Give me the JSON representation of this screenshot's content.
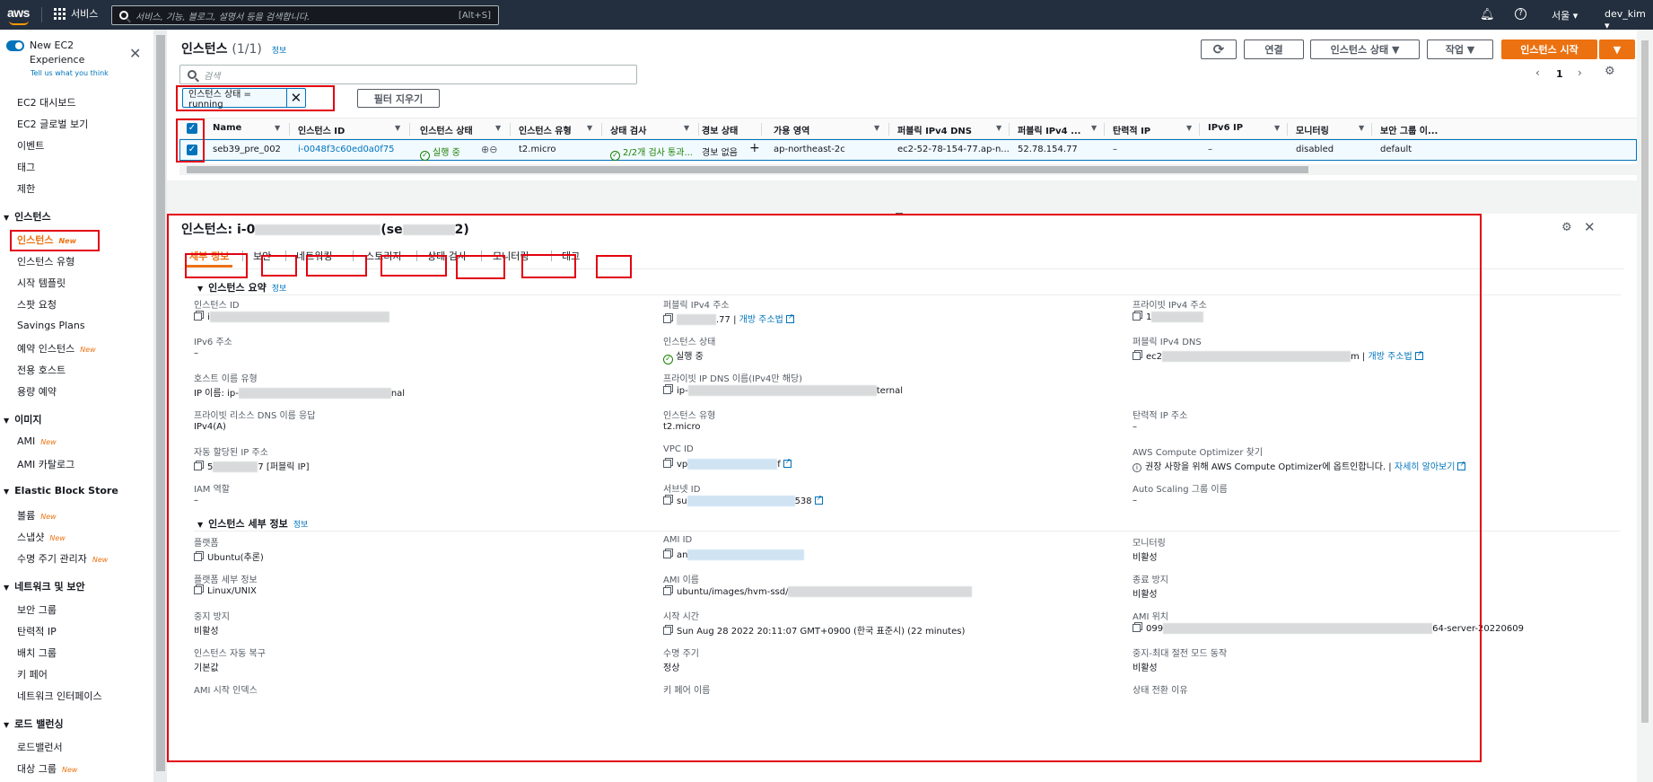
{
  "topbar": {
    "logo": "aws",
    "services": "서비스",
    "search_placeholder": "서비스, 기능, 블로그, 설명서 등을 검색합니다.",
    "search_hotkey": "[Alt+S]",
    "region": "서울 ▾",
    "user": "dev_kim ▾"
  },
  "sidebar": {
    "new_exp": "New EC2 Experience",
    "tell_us": "Tell us what you think",
    "new_badge": "New",
    "items": {
      "dashboard": "EC2 대시보드",
      "global": "EC2 글로벌 보기",
      "events": "이벤트",
      "tags": "태그",
      "limits": "제한",
      "sec_instances": "인스턴스",
      "instances": "인스턴스",
      "instance_types": "인스턴스 유형",
      "launch_templates": "시작 템플릿",
      "spot": "스팟 요청",
      "savings": "Savings Plans",
      "reserved": "예약 인스턴스",
      "dedicated": "전용 호스트",
      "capacity": "용량 예약",
      "sec_images": "이미지",
      "ami": "AMI",
      "ami_catalog": "AMI 카탈로그",
      "sec_ebs": "Elastic Block Store",
      "volumes": "볼륨",
      "snapshots": "스냅샷",
      "lifecycle": "수명 주기 관리자",
      "sec_network": "네트워크 및 보안",
      "security_groups": "보안 그룹",
      "elastic_ip": "탄력적 IP",
      "placement": "배치 그룹",
      "key_pairs": "키 페어",
      "eni": "네트워크 인터페이스",
      "sec_lb": "로드 밸런싱",
      "lb": "로드밸런서",
      "target_groups": "대상 그룹"
    }
  },
  "list": {
    "title": "인스턴스",
    "count": "(1/1)",
    "info": "정보",
    "btn_connect": "연결",
    "btn_state": "인스턴스 상태 ▼",
    "btn_actions": "작업 ▼",
    "btn_launch": "인스턴스 시작",
    "btn_launch_caret": "▼",
    "search_placeholder": "검색",
    "filter_token": "인스턴스 상태 = running",
    "clear_filters": "필터 지우기",
    "page": "1",
    "columns": [
      "Name",
      "인스턴스 ID",
      "인스턴스 상태",
      "인스턴스 유형",
      "상태 검사",
      "경보 상태",
      "가용 영역",
      "퍼블릭 IPv4 DNS",
      "퍼블릭 IPv4 ...",
      "탄력적 IP",
      "IPv6 IP",
      "모니터링",
      "보안 그룹 이..."
    ],
    "row": {
      "name": "seb39_pre_002",
      "id": "i-0048f3c60ed0a0f75",
      "state": "실행 중",
      "type": "t2.micro",
      "check": "2/2개 검사 통과...",
      "alarm": "경보 없음",
      "az": "ap-northeast-2c",
      "dns": "ec2-52-78-154-77.ap-n...",
      "ipv4": "52.78.154.77",
      "eip": "–",
      "ipv6": "–",
      "monitoring": "disabled",
      "sg": "default"
    }
  },
  "detail": {
    "title_prefix": "인스턴스: i-0",
    "title_mid": "(se",
    "title_end": "2)",
    "tabs": [
      "세부 정보",
      "보안",
      "네트워킹",
      "스토리지",
      "상태 검사",
      "모니터링",
      "태그"
    ],
    "summary_title": "인스턴스 요약",
    "info": "정보",
    "details_title": "인스턴스 세부 정보",
    "open_address": "개방 주소법",
    "f": {
      "inst_id_l": "인스턴스 ID",
      "inst_id_v": "i",
      "pub_ip_l": "퍼블릭 IPv4 주소",
      "pub_ip_v": ".77 |",
      "priv_ip_l": "프라이빗 IPv4 주소",
      "priv_ip_v": "1",
      "ipv6_l": "IPv6 주소",
      "ipv6_v": "–",
      "state_l": "인스턴스 상태",
      "state_v": "실행 중",
      "pub_dns_l": "퍼블릭 IPv4 DNS",
      "pub_dns_v": "ec2",
      "pub_dns_end": "m |",
      "hostname_l": "호스트 이름 유형",
      "hostname_v": "IP 이름: ip-",
      "hostname_end": "nal",
      "priv_dns_l": "프라이빗 IP DNS 이름(IPv4만 해당)",
      "priv_dns_v": "ip-",
      "priv_dns_end": "ternal",
      "res_dns_l": "프라이빗 리소스 DNS 이름 응답",
      "res_dns_v": "IPv4(A)",
      "type_l": "인스턴스 유형",
      "type_v": "t2.micro",
      "eip_l": "탄력적 IP 주소",
      "eip_v": "–",
      "auto_ip_l": "자동 할당된 IP 주소",
      "auto_ip_v": "5",
      "auto_ip_end": "7 [퍼블릭 IP]",
      "vpc_l": "VPC ID",
      "vpc_v": "vp",
      "vpc_end": "f",
      "optimizer_l": "AWS Compute Optimizer 찾기",
      "optimizer_v": "권장 사항을 위해 AWS Compute Optimizer에 옵트인합니다. |",
      "optimizer_link": "자세히 알아보기",
      "iam_l": "IAM 역할",
      "iam_v": "–",
      "subnet_l": "서브넷 ID",
      "subnet_v": "su",
      "subnet_end": "538",
      "asg_l": "Auto Scaling 그룹 이름",
      "asg_v": "–",
      "platform_l": "플랫폼",
      "platform_v": "Ubuntu(추론)",
      "ami_id_l": "AMI ID",
      "ami_id_v": "an",
      "monitoring_l": "모니터링",
      "monitoring_v": "비활성",
      "platform_detail_l": "플랫폼 세부 정보",
      "platform_detail_v": "Linux/UNIX",
      "ami_name_l": "AMI 이름",
      "ami_name_v": "ubuntu/images/hvm-ssd/",
      "term_prot_l": "종료 방지",
      "term_prot_v": "비활성",
      "stop_prot_l": "중지 방지",
      "stop_prot_v": "비활성",
      "launch_time_l": "시작 시간",
      "launch_time_v": "Sun Aug 28 2022 20:11:07 GMT+0900 (한국 표준시) (22 minutes)",
      "ami_loc_l": "AMI 위치",
      "ami_loc_v": "099",
      "ami_loc_end": "64-server-20220609",
      "auto_recover_l": "인스턴스 자동 복구",
      "auto_recover_v": "기본값",
      "lifecycle_l": "수명 주기",
      "lifecycle_v": "정상",
      "hibernate_l": "중지-최대 절전 모드 동작",
      "hibernate_v": "비활성",
      "ami_launch_idx_l": "AMI 시작 인덱스",
      "key_pair_l": "키 페어 이름",
      "transition_l": "상태 전환 이유"
    }
  },
  "colors": {
    "accent": "#ec7211",
    "link": "#0073bb",
    "header": "#232f3e",
    "highlight": "#e3000f",
    "running": "#1d8102"
  }
}
